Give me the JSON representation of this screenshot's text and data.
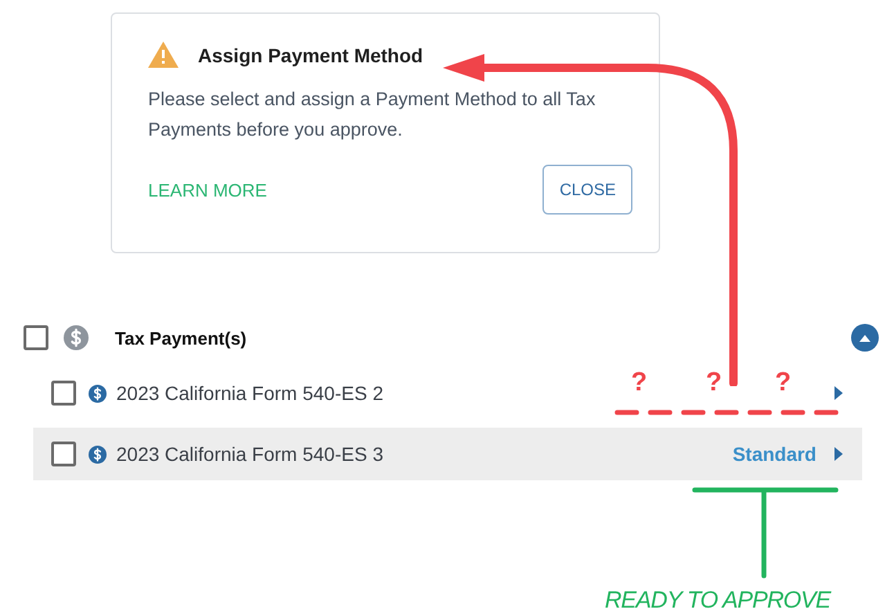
{
  "alert": {
    "title": "Assign Payment Method",
    "message": "Please select and assign a Payment Method to all Tax Payments before you approve.",
    "learn_more": "LEARN MORE",
    "close": "CLOSE"
  },
  "group": {
    "label": "Tax Payment(s)",
    "checked": false,
    "expanded": true,
    "items": [
      {
        "name": "2023 California Form 540-ES 2",
        "checked": false,
        "selected": false,
        "annotation_marks": [
          "?",
          "?",
          "?"
        ]
      },
      {
        "name": "2023 California Form 540-ES 3",
        "checked": false,
        "selected": true,
        "method": "Standard"
      }
    ]
  },
  "annotations": {
    "note": "READY TO APPROVE"
  }
}
